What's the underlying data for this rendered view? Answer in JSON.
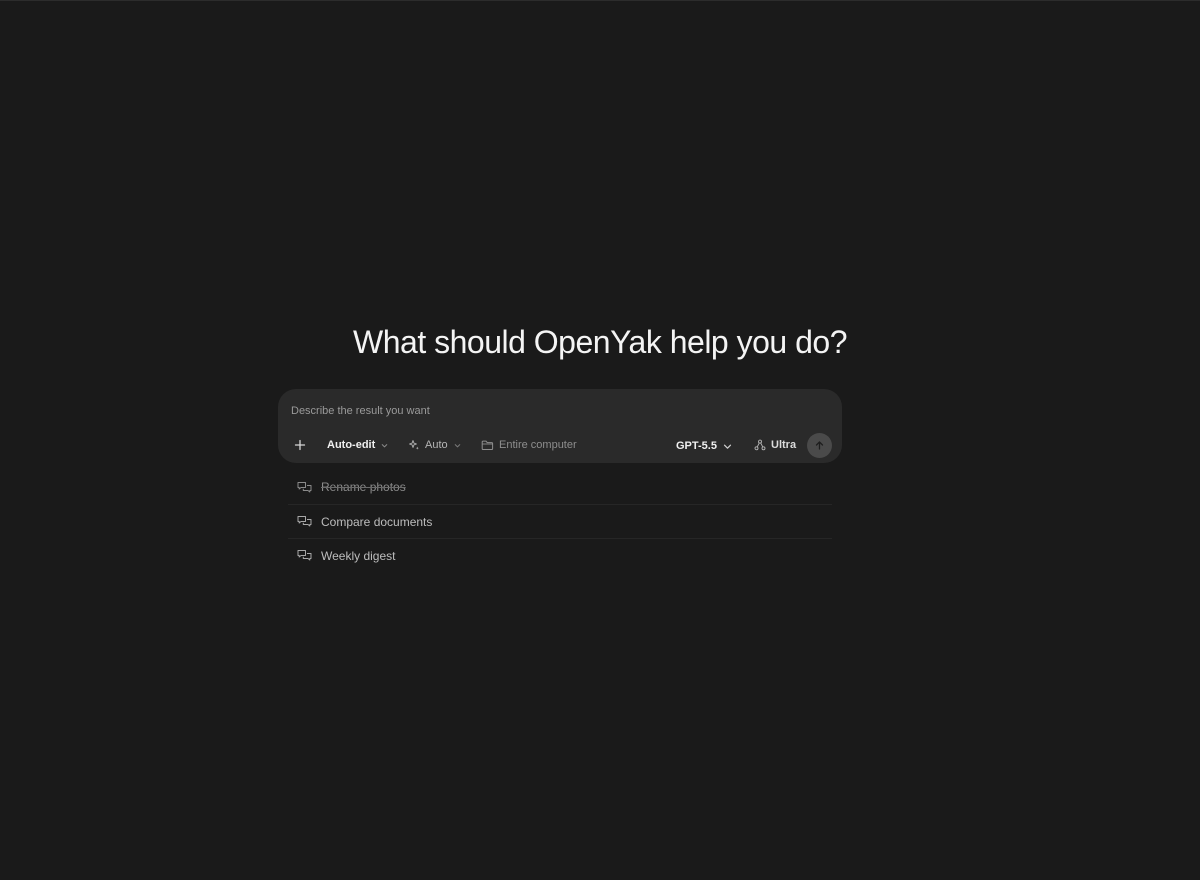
{
  "heading": "What should OpenYak help you do?",
  "composer": {
    "placeholder": "Describe the result you want",
    "mode_label": "Auto-edit",
    "reasoning_label": "Auto",
    "scope_label": "Entire computer",
    "model_label": "GPT-5.5",
    "effort_label": "Ultra"
  },
  "suggestions": [
    {
      "label": "Rename photos"
    },
    {
      "label": "Compare documents"
    },
    {
      "label": "Weekly digest"
    }
  ],
  "colors": {
    "background": "#1a1a1a",
    "composer_bg": "#2a2a2a",
    "send_button_bg": "#4a4a4a"
  },
  "icons": [
    "plus-icon",
    "chevron-down-icon",
    "sparkle-icon",
    "folder-icon",
    "nodes-icon",
    "arrow-up-icon",
    "chat-bubbles-icon"
  ]
}
